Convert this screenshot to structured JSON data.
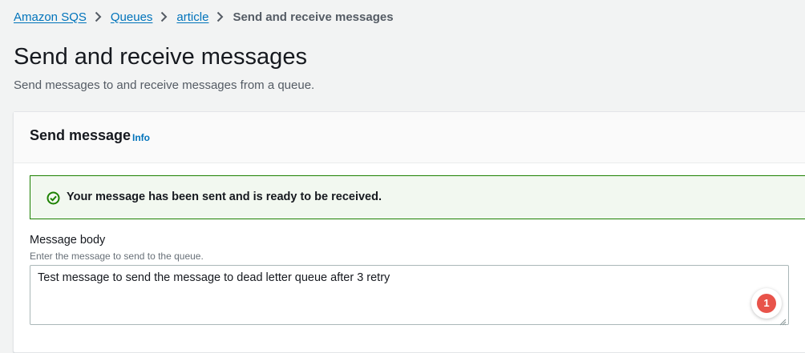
{
  "breadcrumb": {
    "items": [
      {
        "label": "Amazon SQS",
        "link": true
      },
      {
        "label": "Queues",
        "link": true
      },
      {
        "label": "article",
        "link": true
      },
      {
        "label": "Send and receive messages",
        "link": false
      }
    ],
    "separator_icon": "chevron-right-icon"
  },
  "page": {
    "title": "Send and receive messages",
    "description": "Send messages to and receive messages from a queue."
  },
  "send_message": {
    "title": "Send message",
    "info_label": "Info",
    "alert": {
      "type": "success",
      "icon": "check-circle-icon",
      "text": "Your message has been sent and is ready to be received."
    },
    "message_body": {
      "label": "Message body",
      "description": "Enter the message to send to the queue.",
      "value": "Test message to send the message to dead letter queue after 3 retry"
    }
  },
  "notification": {
    "count": "1"
  },
  "colors": {
    "link": "#0073bb",
    "success_border": "#1d8102",
    "success_bg": "#f2f8f0",
    "badge": "#e8534a",
    "page_bg": "#f2f3f3"
  }
}
